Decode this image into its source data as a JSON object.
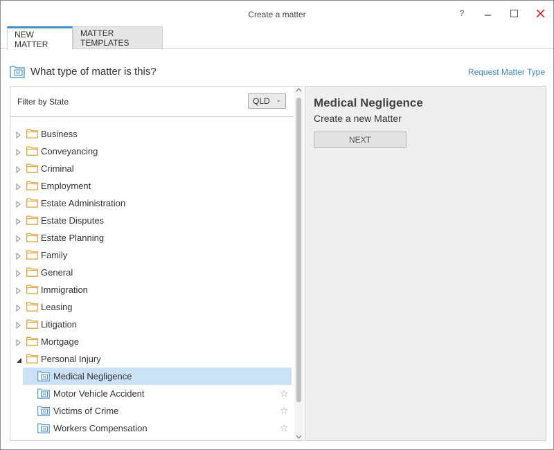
{
  "window": {
    "title": "Create a matter",
    "help_label": "?",
    "minimize_label": "–",
    "maximize_label": "☐",
    "close_label": "✕"
  },
  "tabs": [
    {
      "label": "NEW MATTER",
      "active": true
    },
    {
      "label": "MATTER TEMPLATES",
      "active": false
    }
  ],
  "header": {
    "question": "What type of matter is this?",
    "request_link": "Request Matter Type",
    "icon": "matter-icon"
  },
  "filter": {
    "label": "Filter by State",
    "selected": "QLD",
    "chevron": "⌄"
  },
  "tree": {
    "categories": [
      {
        "label": "Business",
        "expanded": false
      },
      {
        "label": "Conveyancing",
        "expanded": false
      },
      {
        "label": "Criminal",
        "expanded": false
      },
      {
        "label": "Employment",
        "expanded": false
      },
      {
        "label": "Estate Administration",
        "expanded": false
      },
      {
        "label": "Estate Disputes",
        "expanded": false
      },
      {
        "label": "Estate Planning",
        "expanded": false
      },
      {
        "label": "Family",
        "expanded": false
      },
      {
        "label": "General",
        "expanded": false
      },
      {
        "label": "Immigration",
        "expanded": false
      },
      {
        "label": "Leasing",
        "expanded": false
      },
      {
        "label": "Litigation",
        "expanded": false
      },
      {
        "label": "Mortgage",
        "expanded": false
      },
      {
        "label": "Personal Injury",
        "expanded": true
      }
    ],
    "children": [
      {
        "label": "Medical Negligence",
        "selected": true,
        "star": ""
      },
      {
        "label": "Motor Vehicle Accident",
        "selected": false,
        "star": "☆"
      },
      {
        "label": "Victims of Crime",
        "selected": false,
        "star": "☆"
      },
      {
        "label": "Workers Compensation",
        "selected": false,
        "star": "☆"
      }
    ]
  },
  "detail": {
    "title": "Medical Negligence",
    "subtitle": "Create a new Matter",
    "next_label": "NEXT"
  },
  "colors": {
    "accent": "#3c8fd3",
    "link": "#3a87c9",
    "selection": "#cbe2f6",
    "folder": "#e8a33d",
    "close": "#dd1111"
  }
}
